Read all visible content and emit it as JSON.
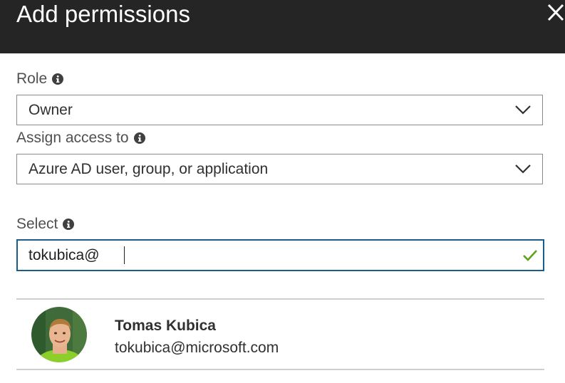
{
  "header": {
    "title": "Add permissions",
    "close_icon": "close-icon"
  },
  "role": {
    "label": "Role",
    "value": "Owner"
  },
  "assign_access": {
    "label": "Assign access to",
    "value": "Azure AD user, group, or application"
  },
  "select": {
    "label": "Select",
    "value": "tokubica@",
    "status_icon": "checkmark-icon",
    "status_color": "#5ea318"
  },
  "results": [
    {
      "name": "Tomas Kubica",
      "email": "tokubica@microsoft.com",
      "avatar_icon": "avatar"
    }
  ],
  "colors": {
    "header_bg": "#252525",
    "input_focus_border": "#1a5c8c",
    "dropdown_border": "#8a8a8a"
  }
}
